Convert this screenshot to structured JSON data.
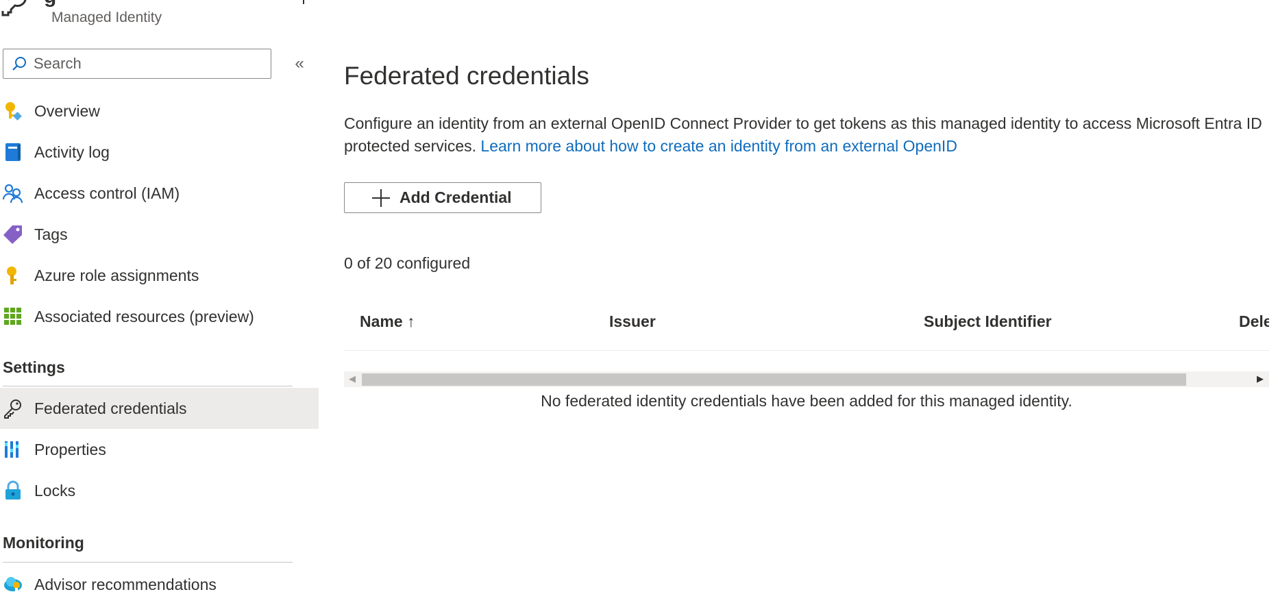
{
  "header": {
    "subtitle": "Managed Identity"
  },
  "search": {
    "placeholder": "Search",
    "value": ""
  },
  "sidebar": {
    "collapse_glyph": "«",
    "items": [
      {
        "label": "Overview",
        "icon": "managed-identity-overview-icon"
      },
      {
        "label": "Activity log",
        "icon": "activity-log-icon"
      },
      {
        "label": "Access control (IAM)",
        "icon": "people-icon"
      },
      {
        "label": "Tags",
        "icon": "tag-icon"
      },
      {
        "label": "Azure role assignments",
        "icon": "key-icon"
      },
      {
        "label": "Associated resources (preview)",
        "icon": "grid-icon"
      }
    ],
    "settings_title": "Settings",
    "settings_items": [
      {
        "label": "Federated credentials",
        "icon": "key-outline-icon",
        "selected": true
      },
      {
        "label": "Properties",
        "icon": "properties-icon"
      },
      {
        "label": "Locks",
        "icon": "lock-icon"
      }
    ],
    "monitoring_title": "Monitoring",
    "monitoring_items": [
      {
        "label": "Advisor recommendations",
        "icon": "advisor-cloud-icon"
      }
    ]
  },
  "main": {
    "title": "Federated credentials",
    "description": "Configure an identity from an external OpenID Connect Provider to get tokens as this managed identity to access Microsoft Entra ID protected services.",
    "learn_more_link": "Learn more about how to create an identity from an external OpenID",
    "add_button_label": "Add Credential",
    "count_text": "0 of 20 configured",
    "table": {
      "columns": [
        "Name ↑",
        "Issuer",
        "Subject Identifier",
        "Dele"
      ],
      "empty_message": "No federated identity credentials have been added for this managed identity."
    }
  },
  "colors": {
    "accent": "#0f6cbd",
    "selected_bg": "#edebe9",
    "text": "#323130"
  }
}
